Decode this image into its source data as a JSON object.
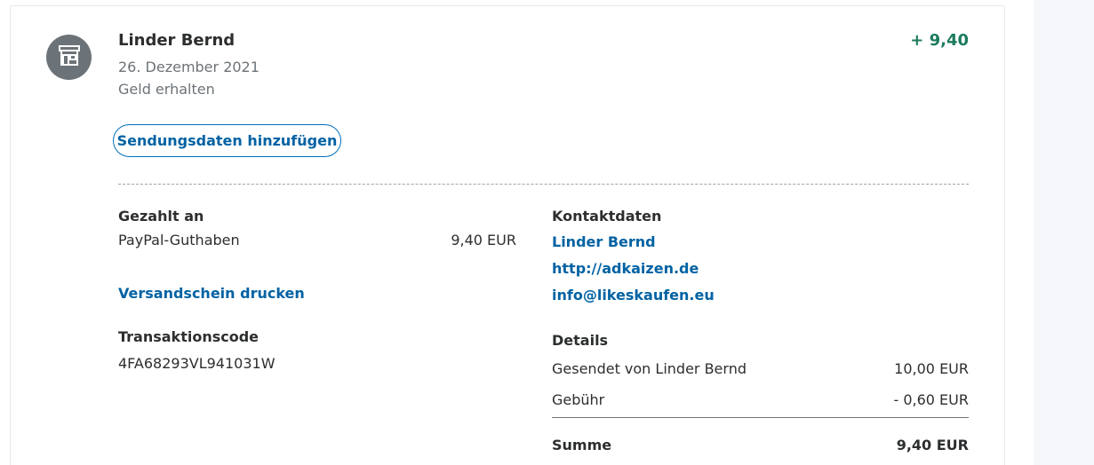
{
  "transaction": {
    "name": "Linder Bernd",
    "date": "26. Dezember 2021",
    "status": "Geld erhalten",
    "amount": "+ 9,40"
  },
  "actions": {
    "add_shipping": "Sendungsdaten hinzufügen",
    "print_label": "Versandschein drucken"
  },
  "paid_to": {
    "heading": "Gezahlt an",
    "method": "PayPal-Guthaben",
    "amount": "9,40 EUR"
  },
  "transaction_code": {
    "heading": "Transaktionscode",
    "value": "4FA68293VL941031W"
  },
  "contact": {
    "heading": "Kontaktdaten",
    "name": "Linder Bernd",
    "website": "http://adkaizen.de",
    "email": "info@likeskaufen.eu"
  },
  "details": {
    "heading": "Details",
    "rows": [
      {
        "label": "Gesendet von Linder Bernd",
        "value": "10,00 EUR"
      },
      {
        "label": "Gebühr",
        "value": "- 0,60 EUR"
      }
    ],
    "total_label": "Summe",
    "total_value": "9,40 EUR"
  },
  "icons": {
    "avatar": "store-icon"
  },
  "colors": {
    "link": "#0062a3",
    "positive_amount": "#1b7b5e",
    "avatar_bg": "#6c7378"
  }
}
